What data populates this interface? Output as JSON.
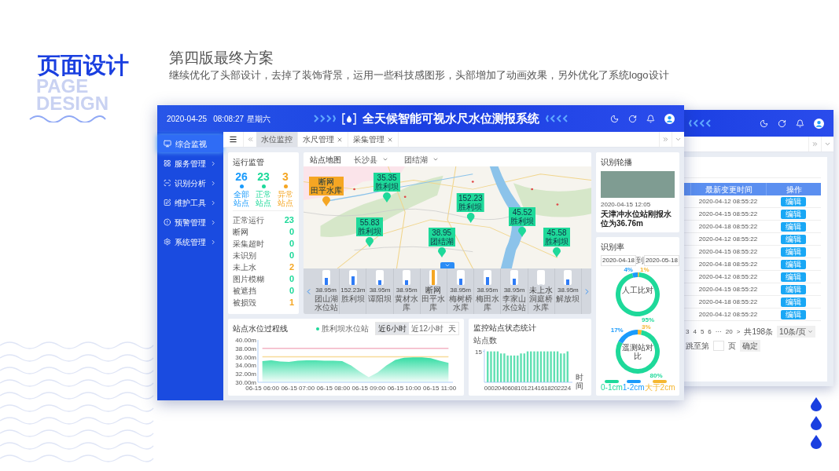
{
  "slide": {
    "heading": "页面设计",
    "ghost_lines": [
      "PAGE",
      "DESIGN"
    ],
    "title": "第四版最终方案",
    "subtitle": "继续优化了头部设计，去掉了装饰背景，运用一些科技感图形，头部增加了动画效果，另外优化了系统logo设计"
  },
  "window": {
    "date": "2020-04-25",
    "time": "08:08:27",
    "weekday": "星期六",
    "title": "全天候智能可视水尺水位测报系统"
  },
  "sidebar": {
    "items": [
      {
        "label": "综合监视",
        "selected": true,
        "has_submenu": false
      },
      {
        "label": "服务管理",
        "selected": false,
        "has_submenu": true
      },
      {
        "label": "识别分析",
        "selected": false,
        "has_submenu": true
      },
      {
        "label": "维护工具",
        "selected": false,
        "has_submenu": true
      },
      {
        "label": "预警管理",
        "selected": false,
        "has_submenu": true
      },
      {
        "label": "系统管理",
        "selected": false,
        "has_submenu": true
      }
    ]
  },
  "tabs": [
    {
      "label": "水位监控",
      "selected": true,
      "closable": false
    },
    {
      "label": "水尺管理",
      "selected": false,
      "closable": true
    },
    {
      "label": "采集管理",
      "selected": false,
      "closable": true
    }
  ],
  "monitor": {
    "title": "运行监管",
    "stats": [
      {
        "value": "26",
        "label": "全部站点",
        "color": "#1a9bfc"
      },
      {
        "value": "23",
        "label": "正常站点",
        "color": "#1ed99a"
      },
      {
        "value": "3",
        "label": "异常站点",
        "color": "#f5a623"
      }
    ],
    "rows": [
      {
        "label": "正常运行",
        "value": "23",
        "color": "#1ed99a"
      },
      {
        "label": "断网",
        "value": "0",
        "color": "#1ed99a"
      },
      {
        "label": "采集超时",
        "value": "0",
        "color": "#1ed99a"
      },
      {
        "label": "未识别",
        "value": "0",
        "color": "#1ed99a"
      },
      {
        "label": "未上水",
        "value": "2",
        "color": "#f5a623"
      },
      {
        "label": "图片模糊",
        "value": "0",
        "color": "#1ed99a"
      },
      {
        "label": "被遮挡",
        "value": "0",
        "color": "#1ed99a"
      },
      {
        "label": "被损毁",
        "value": "1",
        "color": "#f5a623"
      }
    ]
  },
  "map": {
    "title": "站点地图",
    "selects": [
      "长沙县",
      "团结湖"
    ],
    "markers": [
      {
        "value": "断网",
        "name": "田平水库",
        "color": "#f5a623"
      },
      {
        "value": "35.35",
        "name": "胜利坝",
        "color": "#1ed99a"
      },
      {
        "value": "152.23",
        "name": "胜利坝",
        "color": "#1ed99a"
      },
      {
        "value": "55.83",
        "name": "胜利坝",
        "color": "#1ed99a"
      },
      {
        "value": "38.95",
        "name": "团结湖",
        "color": "#1ed99a"
      },
      {
        "value": "45.52",
        "name": "胜利坝",
        "color": "#1ed99a"
      },
      {
        "value": "45.58",
        "name": "胜利坝",
        "color": "#1ed99a"
      }
    ],
    "stations": [
      {
        "kind": "reading",
        "reading": "38.95",
        "unit": "m",
        "name": "团山湖水位站",
        "level": 0.45,
        "color": "#2f7cf6"
      },
      {
        "kind": "reading",
        "reading": "152.23",
        "unit": "m",
        "name": "胜利坝",
        "level": 0.6,
        "color": "#2f7cf6"
      },
      {
        "kind": "reading",
        "reading": "38.95",
        "unit": "m",
        "name": "谭阳坝",
        "level": 0.3,
        "color": "#2f7cf6"
      },
      {
        "kind": "reading",
        "reading": "38.95",
        "unit": "m",
        "name": "黄材水库",
        "level": 0.3,
        "color": "#2f7cf6"
      },
      {
        "kind": "status",
        "reading": "断网",
        "name": "田平水库",
        "level": 1,
        "color": "#f5a623"
      },
      {
        "kind": "reading",
        "reading": "38.95",
        "unit": "m",
        "name": "梅树桥水库",
        "level": 0.4,
        "color": "#2f7cf6"
      },
      {
        "kind": "reading",
        "reading": "38.95",
        "unit": "m",
        "name": "梅田水库",
        "level": 0.55,
        "color": "#2f7cf6"
      },
      {
        "kind": "reading",
        "reading": "38.95",
        "unit": "m",
        "name": "李家山水位站",
        "level": 0.4,
        "color": "#2f7cf6"
      },
      {
        "kind": "status",
        "reading": "未上水",
        "name": "洞庭桥水库",
        "level": 0
      },
      {
        "kind": "reading",
        "reading": "38.95",
        "unit": "m",
        "name": "解放坝",
        "level": 0.35,
        "color": "#2f7cf6"
      }
    ]
  },
  "carousel": {
    "title": "识别轮播",
    "time": "2020-04-15 12:05",
    "caption": "天津冲水位站刚报水位为36.76m"
  },
  "recognition": {
    "title": "识别率",
    "from": "2020-04-18",
    "separator": "到",
    "to": "2020-05-18",
    "charts": [
      {
        "chart_data": {
          "type": "donut",
          "title": "人工比对",
          "values": [
            95,
            4,
            1
          ],
          "value_labels": [
            "95%",
            "4%",
            "1%"
          ]
        }
      },
      {
        "chart_data": {
          "type": "donut",
          "title": "遥测站对比",
          "values": [
            80,
            17,
            3
          ],
          "value_labels": [
            "80%",
            "17%",
            "3%"
          ]
        }
      }
    ],
    "legend": [
      {
        "label": "0-1cm",
        "color": "#1ed99a"
      },
      {
        "label": "1-2cm",
        "color": "#1a9bfc"
      },
      {
        "label": "大于2cm",
        "color": "#f5b731"
      }
    ]
  },
  "level_chart": {
    "title": "站点水位过程线",
    "ranges": [
      {
        "label": "近6小时",
        "selected": true
      },
      {
        "label": "近12小时",
        "selected": false
      },
      {
        "label": "天",
        "selected": false
      }
    ],
    "chart_data": {
      "type": "area",
      "categories": [
        "06-15 06:00",
        null,
        null,
        null,
        "06-15 07:00",
        null,
        null,
        null,
        "06-15 08:00",
        null,
        null,
        null,
        "06-15 09:00",
        null,
        null,
        null,
        "06-15 10:00",
        null,
        null,
        null,
        "06-15 11:00",
        null
      ],
      "series": [
        {
          "name": "胜利坝水位站",
          "color": "#1ed99a",
          "values": [
            35.0,
            35.2,
            34.9,
            34.8,
            35.1,
            35.2,
            35.2,
            35.1,
            35.1,
            35.0,
            34.0,
            32.5,
            31.2,
            32.3,
            34.0,
            35.3,
            35.8,
            35.9,
            35.9,
            35.7,
            35.1,
            34.6
          ]
        },
        {
          "type": "line",
          "color": "#f3b3c4",
          "values": [
            38,
            38,
            38,
            38,
            38,
            38,
            38,
            38,
            38,
            38,
            38,
            38,
            38,
            38,
            38,
            38,
            38,
            38,
            38,
            38,
            38,
            38
          ]
        },
        {
          "type": "line",
          "color": "#f7dc9a",
          "values": [
            36,
            36,
            36,
            36,
            36,
            36,
            36,
            36,
            36,
            36,
            36,
            36,
            36,
            36,
            36,
            36,
            36,
            36,
            36,
            36,
            36,
            36
          ]
        }
      ],
      "ylim": [
        30,
        40
      ],
      "yticks": [
        {
          "value": 30,
          "label": "30.00m"
        },
        {
          "value": 32,
          "label": "32.00m"
        },
        {
          "value": 34,
          "label": "34.00m"
        },
        {
          "value": 36,
          "label": "36.00m"
        },
        {
          "value": 38,
          "label": "38.00m"
        },
        {
          "value": 40,
          "label": "40.00m"
        }
      ],
      "grid": false
    }
  },
  "status_chart": {
    "title": "监控站点状态统计",
    "chart_data": {
      "type": "bar",
      "ylim": [
        0,
        16
      ],
      "yticks": [
        {
          "value": 15,
          "label": "15"
        }
      ],
      "ylabel": "站点数",
      "xlabel": "时间",
      "x": [
        0,
        1,
        2,
        3,
        4,
        5,
        6,
        7,
        8,
        9,
        10,
        11,
        12,
        13,
        14,
        15,
        16,
        17,
        18,
        19,
        20,
        21,
        22,
        23,
        24
      ],
      "values": [
        15,
        15,
        15,
        15,
        14,
        14,
        13,
        13,
        13,
        13,
        14,
        14,
        15,
        15,
        15,
        15,
        15,
        15,
        15,
        15,
        15,
        15,
        14,
        14,
        15
      ],
      "xlim": [
        -1,
        25
      ],
      "xticks": [
        {
          "value": 0,
          "label": "00"
        },
        {
          "value": 2,
          "label": "02"
        },
        {
          "value": 4,
          "label": "04"
        },
        {
          "value": 6,
          "label": "06"
        },
        {
          "value": 8,
          "label": "08"
        },
        {
          "value": 10,
          "label": "10"
        },
        {
          "value": 12,
          "label": "12"
        },
        {
          "value": 14,
          "label": "14"
        },
        {
          "value": 16,
          "label": "16"
        },
        {
          "value": 18,
          "label": "18"
        },
        {
          "value": 20,
          "label": "20"
        },
        {
          "value": 22,
          "label": "22"
        },
        {
          "value": 24,
          "label": "24"
        }
      ]
    }
  },
  "back_window": {
    "columns": [
      "最新变更时间",
      "操作"
    ],
    "rows": [
      {
        "time": "2020-04-12 08:55:22",
        "action": "编辑"
      },
      {
        "time": "2020-04-15 08:55:22",
        "action": "编辑"
      },
      {
        "time": "2020-04-18 08:55:22",
        "action": "编辑"
      },
      {
        "time": "2020-04-12 08:55:22",
        "action": "编辑"
      },
      {
        "time": "2020-04-15 08:55:22",
        "action": "编辑"
      },
      {
        "time": "2020-04-18 08:55:22",
        "action": "编辑"
      },
      {
        "time": "2020-04-12 08:55:22",
        "action": "编辑"
      },
      {
        "time": "2020-04-15 08:55:22",
        "action": "编辑"
      },
      {
        "time": "2020-04-18 08:55:22",
        "action": "编辑"
      },
      {
        "time": "2020-04-12 08:55:22",
        "action": "编辑"
      }
    ],
    "pages": [
      "3",
      "4",
      "5",
      "6",
      "···",
      "20"
    ],
    "next": ">",
    "total": "共198条",
    "page_size": "10条/页",
    "jump_label": "跳至第",
    "page_unit": "页",
    "confirm": "确定"
  }
}
